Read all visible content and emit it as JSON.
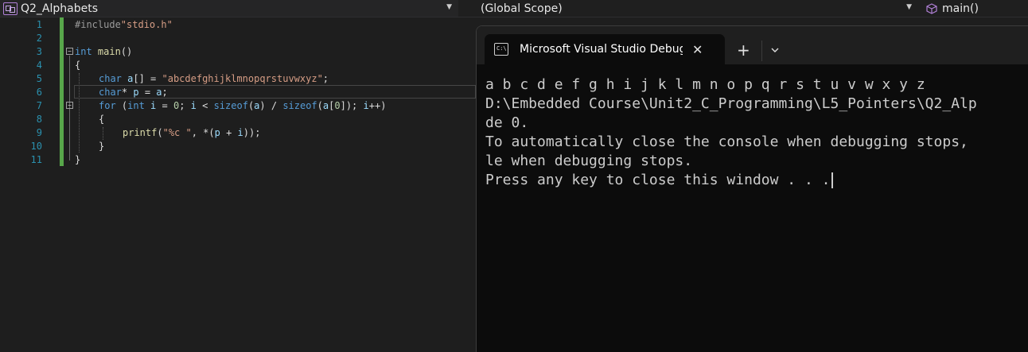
{
  "navbar": {
    "project": "Q2_Alphabets",
    "scope": "(Global Scope)",
    "member": "main()"
  },
  "editor": {
    "line_numbers": [
      "1",
      "2",
      "3",
      "4",
      "5",
      "6",
      "7",
      "8",
      "9",
      "10",
      "11"
    ],
    "lines": {
      "l1_directive": "#include",
      "l1_header": "\"stdio.h\"",
      "l3_type": "int",
      "l3_name": "main",
      "l3_parens": "()",
      "l4": "{",
      "l5_type": "char",
      "l5_var": "a",
      "l5_mid": "[] = ",
      "l5_str": "\"abcdefghijklmnopqrstuvwxyz\"",
      "l5_end": ";",
      "l6_type": "char",
      "l6_star": "* ",
      "l6_var": "p",
      "l6_mid": " = ",
      "l6_var2": "a",
      "l6_end": ";",
      "l7_for": "for",
      "l7_open": " (",
      "l7_int": "int",
      "l7_i": " i",
      "l7_eq": " = ",
      "l7_zero": "0",
      "l7_semi": "; ",
      "l7_i2": "i",
      "l7_lt": " < ",
      "l7_sizeof": "sizeof",
      "l7_p1": "(",
      "l7_a": "a",
      "l7_p2": ") / ",
      "l7_sizeof2": "sizeof",
      "l7_p3": "(",
      "l7_a2": "a",
      "l7_br1": "[",
      "l7_zero2": "0",
      "l7_br2": "]); ",
      "l7_i3": "i",
      "l7_inc": "++)",
      "l8": "{",
      "l9_fn": "printf",
      "l9_p1": "(",
      "l9_str": "\"%c \"",
      "l9_mid": ", *(",
      "l9_p": "p",
      "l9_plus": " + ",
      "l9_i": "i",
      "l9_end": "));",
      "l10": "}",
      "l11": "}"
    }
  },
  "console": {
    "tab_title": "Microsoft Visual Studio Debug Console",
    "output": [
      "a b c d e f g h i j k l m n o p q r s t u v w x y z",
      "D:\\Embedded Course\\Unit2_C_Programming\\L5_Pointers\\Q2_Alp",
      "de 0.",
      "To automatically close the console when debugging stops,",
      "le when debugging stops.",
      "Press any key to close this window . . ."
    ]
  },
  "colors": {
    "keyword": "#569cd6",
    "function": "#dcdcaa",
    "string": "#d69d85",
    "variable": "#9cdcfe",
    "line_number": "#2b91af",
    "change_bar": "#57a64a"
  }
}
